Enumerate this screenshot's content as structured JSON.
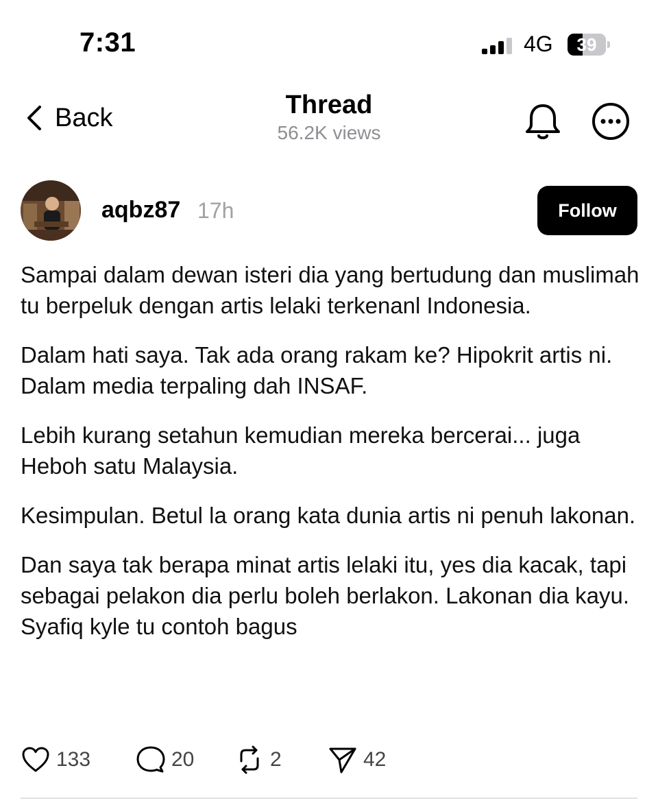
{
  "status_bar": {
    "time": "7:31",
    "network": "4G",
    "battery": "39",
    "battery_level": 0.39
  },
  "nav": {
    "back_label": "Back",
    "title": "Thread",
    "views": "56.2K views",
    "icons": [
      "chevron-left-icon",
      "bell-icon",
      "more-icon"
    ]
  },
  "post": {
    "username": "aqbz87",
    "time_ago": "17h",
    "follow_label": "Follow",
    "paragraphs": [
      "Sampai dalam dewan isteri dia yang bertudung dan muslimah tu berpeluk dengan artis lelaki terkenanl Indonesia.",
      "Dalam hati saya. Tak ada orang rakam ke? Hipokrit artis ni. Dalam media terpaling dah INSAF.",
      "Lebih kurang setahun kemudian mereka bercerai... juga Heboh satu Malaysia.",
      "Kesimpulan. Betul la orang kata dunia artis ni penuh lakonan.",
      "Dan saya tak berapa minat artis lelaki itu, yes dia kacak, tapi sebagai pelakon dia perlu boleh berlakon. Lakonan dia kayu. Syafiq kyle tu contoh bagus"
    ],
    "actions": {
      "likes": "133",
      "replies": "20",
      "reposts": "2",
      "shares": "42"
    }
  },
  "colors": {
    "text": "#000000",
    "secondary": "#8e8e93",
    "follow_bg": "#000000",
    "follow_text": "#ffffff"
  }
}
